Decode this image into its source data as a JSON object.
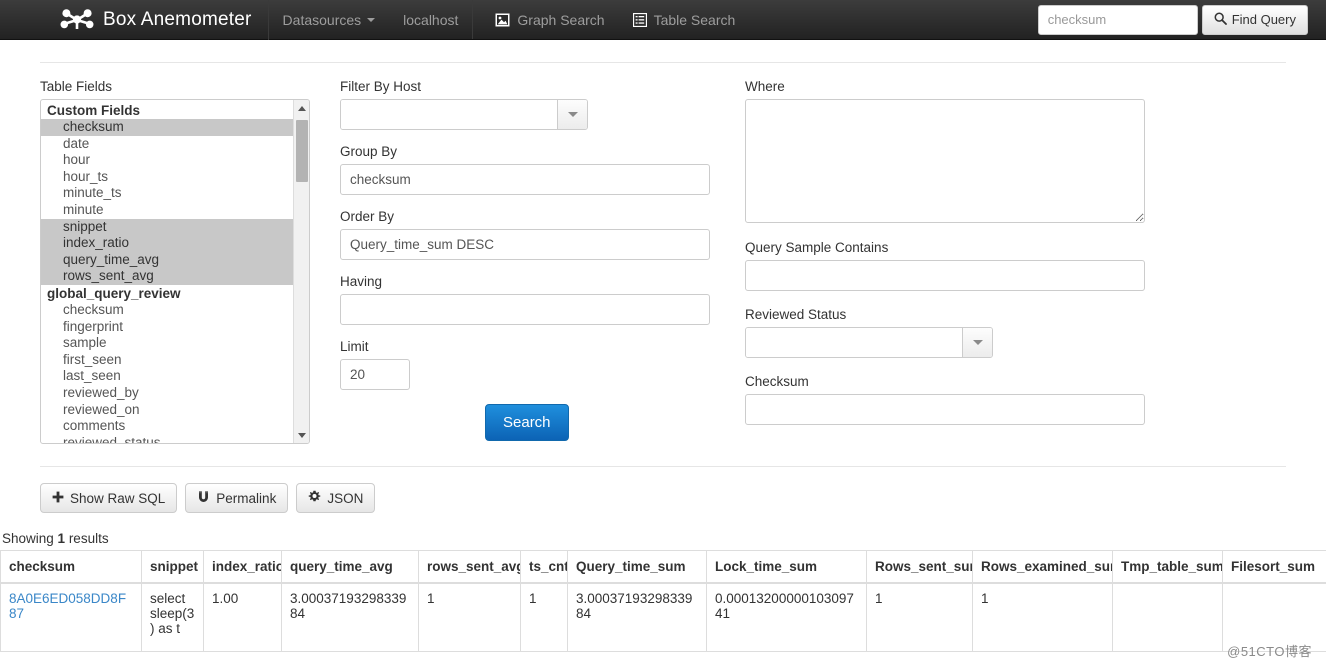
{
  "navbar": {
    "brand": "Box Anemometer",
    "logo_icon": "network-nodes-icon",
    "items": [
      {
        "label": "Datasources",
        "icon": "caret-down-icon",
        "has_caret": true
      },
      {
        "label": "localhost",
        "icon": "",
        "has_caret": false
      }
    ],
    "links": [
      {
        "label": "Graph Search",
        "icon": "picture-icon"
      },
      {
        "label": "Table Search",
        "icon": "list-alt-icon"
      }
    ],
    "search": {
      "value": "",
      "placeholder": "checksum",
      "button_label": "Find Query",
      "button_icon": "search-icon"
    }
  },
  "form": {
    "table_fields": {
      "label": "Table Fields",
      "groups": [
        {
          "name": "Custom Fields",
          "items": [
            {
              "label": "checksum",
              "selected": true
            },
            {
              "label": "date",
              "selected": false
            },
            {
              "label": "hour",
              "selected": false
            },
            {
              "label": "hour_ts",
              "selected": false
            },
            {
              "label": "minute_ts",
              "selected": false
            },
            {
              "label": "minute",
              "selected": false
            },
            {
              "label": "snippet",
              "selected": true
            },
            {
              "label": "index_ratio",
              "selected": true
            },
            {
              "label": "query_time_avg",
              "selected": true
            },
            {
              "label": "rows_sent_avg",
              "selected": true
            }
          ]
        },
        {
          "name": "global_query_review",
          "items": [
            {
              "label": "checksum",
              "selected": false
            },
            {
              "label": "fingerprint",
              "selected": false
            },
            {
              "label": "sample",
              "selected": false
            },
            {
              "label": "first_seen",
              "selected": false
            },
            {
              "label": "last_seen",
              "selected": false
            },
            {
              "label": "reviewed_by",
              "selected": false
            },
            {
              "label": "reviewed_on",
              "selected": false
            },
            {
              "label": "comments",
              "selected": false
            },
            {
              "label": "reviewed_status",
              "selected": false
            }
          ]
        }
      ]
    },
    "filter_by_host": {
      "label": "Filter By Host",
      "value": "",
      "placeholder": ""
    },
    "group_by": {
      "label": "Group By",
      "value": "checksum",
      "placeholder": ""
    },
    "order_by": {
      "label": "Order By",
      "value": "Query_time_sum DESC",
      "placeholder": ""
    },
    "having": {
      "label": "Having",
      "value": "",
      "placeholder": ""
    },
    "limit": {
      "label": "Limit",
      "value": "20",
      "placeholder": ""
    },
    "where": {
      "label": "Where",
      "value": "",
      "placeholder": ""
    },
    "query_sample_contains": {
      "label": "Query Sample Contains",
      "value": "",
      "placeholder": ""
    },
    "reviewed_status": {
      "label": "Reviewed Status",
      "value": "",
      "placeholder": ""
    },
    "checksum": {
      "label": "Checksum",
      "value": "",
      "placeholder": ""
    },
    "search_button": "Search"
  },
  "actions": [
    {
      "label": "Show Raw SQL",
      "icon": "plus-icon"
    },
    {
      "label": "Permalink",
      "icon": "magnet-icon"
    },
    {
      "label": "JSON",
      "icon": "gear-icon"
    }
  ],
  "results": {
    "showing_prefix": "Showing ",
    "showing_count": "1",
    "showing_suffix": " results",
    "columns": [
      "checksum",
      "snippet",
      "index_ratio",
      "query_time_avg",
      "rows_sent_avg",
      "ts_cnt",
      "Query_time_sum",
      "Lock_time_sum",
      "Rows_sent_sum",
      "Rows_examined_sum",
      "Tmp_table_sum",
      "Filesort_sum"
    ],
    "rows": [
      {
        "checksum": "8A0E6ED058DD8F87",
        "snippet": "select sleep(3) as t",
        "index_ratio": "1.00",
        "query_time_avg": "3.0003719329833984",
        "rows_sent_avg": "1",
        "ts_cnt": "1",
        "Query_time_sum": "3.0003719329833984",
        "Lock_time_sum": "0.0001320000010309741",
        "Rows_sent_sum": "1",
        "Rows_examined_sum": "1",
        "Tmp_table_sum": "",
        "Filesort_sum": ""
      }
    ]
  },
  "watermark": "@51CTO博客",
  "colors": {
    "navbar_bg": "#2b2b2b",
    "navbar_text": "#9d9d9d",
    "primary": "#1b7fc9",
    "link": "#3a87c8",
    "selection": "#c8c8c8",
    "border": "#cccccc"
  }
}
